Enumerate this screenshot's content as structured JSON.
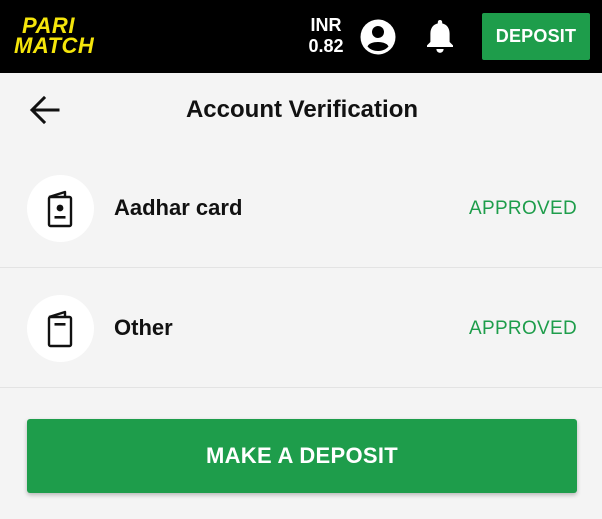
{
  "brand": {
    "logo_line1": "PARI",
    "logo_line2": "MATCH",
    "logo_color": "#f5e50b"
  },
  "header": {
    "currency": "INR",
    "balance": "0.82",
    "user_icon": "account-circle-icon",
    "notification_icon": "bell-icon",
    "deposit_label": "DEPOSIT"
  },
  "page": {
    "back_icon": "arrow-left-icon",
    "title": "Account Verification"
  },
  "documents": [
    {
      "label": "Aadhar card",
      "status": "APPROVED",
      "icon": "id-card-icon"
    },
    {
      "label": "Other",
      "status": "APPROVED",
      "icon": "document-icon"
    }
  ],
  "actions": {
    "make_deposit_label": "MAKE A DEPOSIT"
  },
  "colors": {
    "accent": "#1e9d4b",
    "topbar": "#000000",
    "background": "#f4f4f4"
  }
}
